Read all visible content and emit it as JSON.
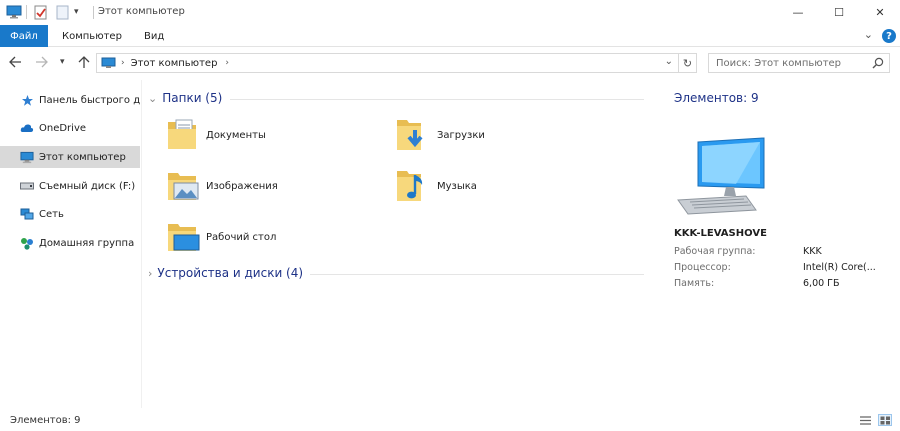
{
  "window": {
    "title": "Этот компьютер",
    "controls": {
      "minimize": "—",
      "maximize": "☐",
      "close": "✕"
    }
  },
  "ribbon": {
    "tabs": [
      {
        "label": "Файл",
        "active": true
      },
      {
        "label": "Компьютер"
      },
      {
        "label": "Вид"
      }
    ],
    "help": "?"
  },
  "address": {
    "path": [
      "Этот компьютер"
    ],
    "search_placeholder": "Поиск: Этот компьютер"
  },
  "sidebar": {
    "items": [
      {
        "label": "Панель быстрого доступа",
        "icon": "star-icon"
      },
      {
        "label": "OneDrive",
        "icon": "cloud-icon"
      },
      {
        "label": "Этот компьютер",
        "icon": "computer-icon",
        "selected": true
      },
      {
        "label": "Съемный диск (F:)",
        "icon": "drive-icon"
      },
      {
        "label": "Сеть",
        "icon": "network-icon"
      },
      {
        "label": "Домашняя группа",
        "icon": "homegroup-icon"
      }
    ]
  },
  "main": {
    "folders_header": "Папки (5)",
    "folders": [
      {
        "label": "Документы",
        "icon": "documents-folder-icon"
      },
      {
        "label": "Загрузки",
        "icon": "downloads-folder-icon"
      },
      {
        "label": "Изображения",
        "icon": "pictures-folder-icon"
      },
      {
        "label": "Музыка",
        "icon": "music-folder-icon"
      },
      {
        "label": "Рабочий стол",
        "icon": "desktop-folder-icon"
      }
    ],
    "devices_header": "Устройства и диски (4)"
  },
  "details": {
    "count": "Элементов: 9",
    "pc_name": "KKK-LEVASHOVE",
    "properties": [
      {
        "key": "Рабочая группа:",
        "value": "KKK"
      },
      {
        "key": "Процессор:",
        "value": "Intel(R) Core(..."
      },
      {
        "key": "Память:",
        "value": "6,00 ГБ"
      }
    ]
  },
  "status": {
    "text": "Элементов: 9"
  },
  "colors": {
    "accent": "#1979ca",
    "header": "#1e3287",
    "selected": "#d9d9d9"
  }
}
